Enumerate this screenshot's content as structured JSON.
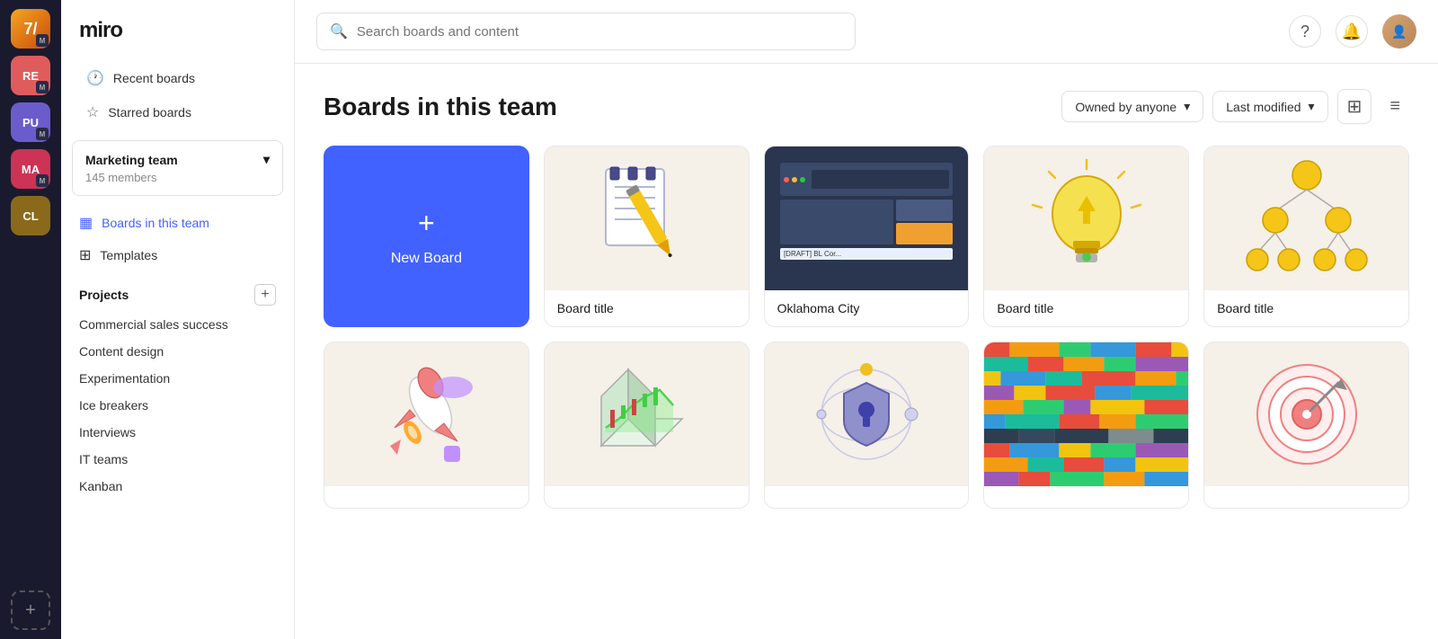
{
  "app": {
    "name": "miro",
    "search_placeholder": "Search boards and content"
  },
  "icon_bar": {
    "teams": [
      {
        "label": "7/",
        "color": "#f5a623",
        "badge": "M"
      },
      {
        "label": "RE",
        "color": "#e05c5c",
        "badge": "M"
      },
      {
        "label": "PU",
        "color": "#6b5ccc",
        "badge": "M"
      },
      {
        "label": "MA",
        "color": "#cc3355",
        "badge": "M"
      },
      {
        "label": "CL",
        "color": "#8a6a1a",
        "badge": ""
      }
    ]
  },
  "sidebar": {
    "nav_items": [
      {
        "label": "Recent boards",
        "icon": "🕐"
      },
      {
        "label": "Starred boards",
        "icon": "☆"
      }
    ],
    "team": {
      "name": "Marketing team",
      "members": "145 members"
    },
    "team_nav": [
      {
        "label": "Boards in this team",
        "icon": "▦",
        "active": true
      },
      {
        "label": "Templates",
        "icon": "⊞",
        "active": false
      }
    ],
    "projects": {
      "title": "Projects",
      "add_label": "+",
      "items": [
        "Commercial sales success",
        "Content design",
        "Experimentation",
        "Ice breakers",
        "Interviews",
        "IT teams",
        "Kanban"
      ]
    }
  },
  "content": {
    "title": "Boards in this team",
    "filter_owner": "Owned by anyone",
    "filter_modified": "Last modified",
    "boards": [
      {
        "id": "new",
        "type": "new",
        "label": "New Board"
      },
      {
        "id": "b1",
        "type": "illustration",
        "title": "Board title",
        "theme": "cream",
        "illustration": "notepad"
      },
      {
        "id": "b2",
        "type": "illustration",
        "title": "Oklahoma City",
        "theme": "dark",
        "illustration": "screenshot"
      },
      {
        "id": "b3",
        "type": "illustration",
        "title": "Board title",
        "theme": "cream",
        "illustration": "bulb"
      },
      {
        "id": "b4",
        "type": "illustration",
        "title": "Board title",
        "theme": "cream",
        "illustration": "tree"
      },
      {
        "id": "b5",
        "type": "illustration",
        "title": "",
        "theme": "cream",
        "illustration": "rocket"
      },
      {
        "id": "b6",
        "type": "illustration",
        "title": "",
        "theme": "cream",
        "illustration": "chart"
      },
      {
        "id": "b7",
        "type": "illustration",
        "title": "",
        "theme": "cream",
        "illustration": "shield"
      },
      {
        "id": "b8",
        "type": "illustration",
        "title": "",
        "theme": "colorful",
        "illustration": "mosaic"
      },
      {
        "id": "b9",
        "type": "illustration",
        "title": "",
        "theme": "cream",
        "illustration": "target"
      }
    ]
  }
}
